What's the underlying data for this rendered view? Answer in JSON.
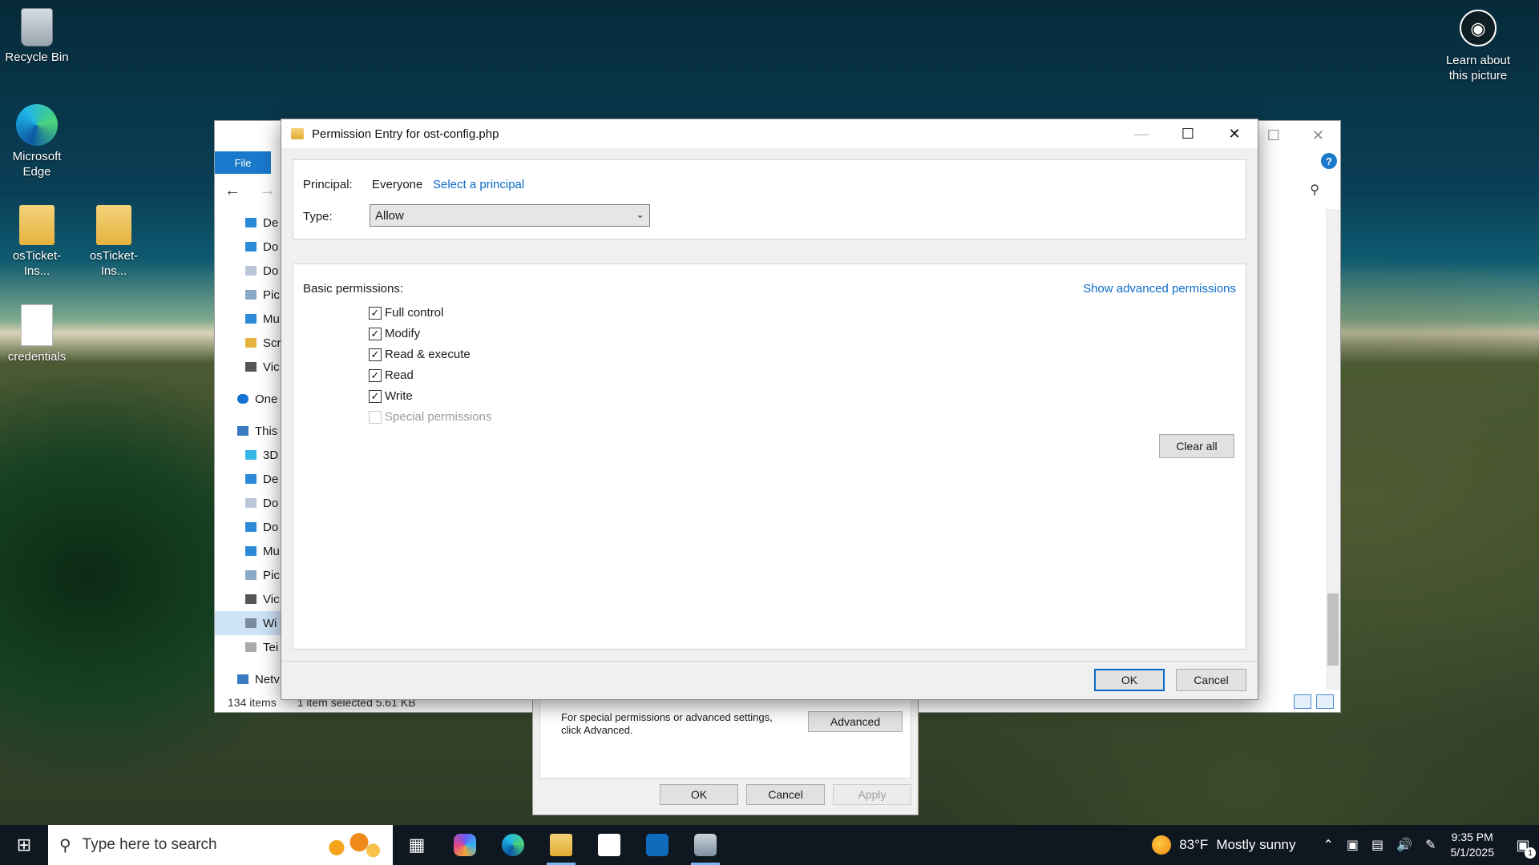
{
  "desktop": {
    "icons": [
      {
        "label": "Recycle Bin",
        "icon": "recycle-bin-icon"
      },
      {
        "label": "Microsoft Edge",
        "icon": "edge-icon"
      },
      {
        "label": "osTicket-Ins...",
        "icon": "zip-folder-icon"
      },
      {
        "label": "osTicket-Ins...",
        "icon": "zip-folder-icon"
      },
      {
        "label": "credentials",
        "icon": "text-file-icon"
      }
    ],
    "learn": {
      "label": "Learn about this picture"
    }
  },
  "explorer": {
    "ribbon_file": "File",
    "nav_items": [
      "De",
      "Do",
      "Do",
      "Pic",
      "Mu",
      "Scr",
      "Vic",
      "One",
      "This",
      "3D",
      "De",
      "Do",
      "Do",
      "Mu",
      "Pic",
      "Vic",
      "Wi",
      "Tei",
      "Netv"
    ],
    "status_items": "134 items",
    "status_selected": "1 item selected  5.61 KB"
  },
  "properties": {
    "hint": "For special permissions or advanced settings, click Advanced.",
    "advanced_label": "Advanced",
    "ok_label": "OK",
    "cancel_label": "Cancel",
    "apply_label": "Apply"
  },
  "dialog": {
    "title": "Permission Entry for ost-config.php",
    "principal_label": "Principal:",
    "principal_value": "Everyone",
    "select_principal": "Select a principal",
    "type_label": "Type:",
    "type_value": "Allow",
    "basic_label": "Basic permissions:",
    "show_advanced": "Show advanced permissions",
    "permissions": [
      {
        "label": "Full control",
        "checked": true,
        "enabled": true
      },
      {
        "label": "Modify",
        "checked": true,
        "enabled": true
      },
      {
        "label": "Read & execute",
        "checked": true,
        "enabled": true
      },
      {
        "label": "Read",
        "checked": true,
        "enabled": true
      },
      {
        "label": "Write",
        "checked": true,
        "enabled": true
      },
      {
        "label": "Special permissions",
        "checked": false,
        "enabled": false
      }
    ],
    "clear_all": "Clear all",
    "ok_label": "OK",
    "cancel_label": "Cancel"
  },
  "taskbar": {
    "search_placeholder": "Type here to search",
    "weather_temp": "83°F",
    "weather_text": "Mostly sunny",
    "time": "9:35 PM",
    "date": "5/1/2025",
    "notification_count": "1"
  },
  "colors": {
    "accent": "#0b6bc9",
    "taskbar": "#0f1721"
  }
}
